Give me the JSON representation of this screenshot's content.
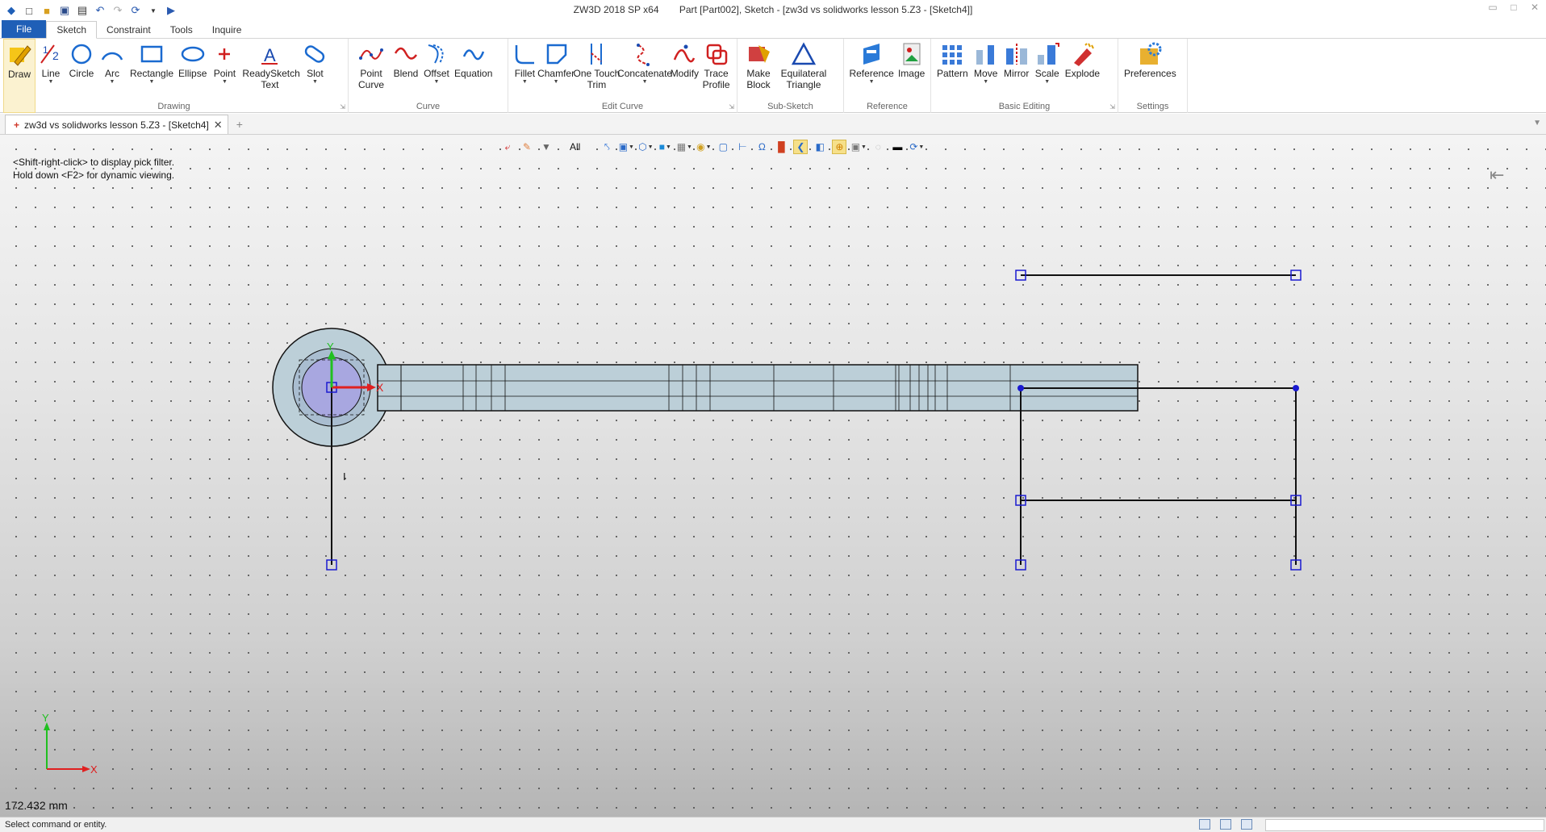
{
  "window": {
    "app_title": "ZW3D 2018 SP x64",
    "doc_title": "Part [Part002],  Sketch - [zw3d vs solidworks lesson 5.Z3 - [Sketch4]]"
  },
  "menu_tabs": [
    "File",
    "Sketch",
    "Constraint",
    "Tools",
    "Inquire"
  ],
  "active_tab": "Sketch",
  "ribbon": {
    "drawing": {
      "label": "Drawing",
      "buttons": [
        "Draw",
        "Line",
        "Circle",
        "Arc",
        "Rectangle",
        "Ellipse",
        "Point",
        "ReadySketch Text",
        "Slot"
      ]
    },
    "curve": {
      "label": "Curve",
      "buttons": [
        "Point Curve",
        "Blend",
        "Offset",
        "Equation"
      ]
    },
    "edit_curve": {
      "label": "Edit Curve",
      "buttons": [
        "Fillet",
        "Chamfer",
        "One Touch Trim",
        "Concatenate",
        "Modify",
        "Trace Profile"
      ]
    },
    "sub_sketch": {
      "label": "Sub-Sketch",
      "buttons": [
        "Make Block",
        "Equilateral Triangle"
      ]
    },
    "reference": {
      "label": "Reference",
      "buttons": [
        "Reference",
        "Image"
      ]
    },
    "basic_editing": {
      "label": "Basic Editing",
      "buttons": [
        "Pattern",
        "Move",
        "Mirror",
        "Scale",
        "Explode"
      ]
    },
    "settings": {
      "label": "Settings",
      "buttons": [
        "Preferences"
      ]
    }
  },
  "doc_tab": "zw3d vs solidworks lesson 5.Z3 - [Sketch4]",
  "viewport": {
    "filter": "All",
    "hint_line1": "<Shift-right-click> to display pick filter.",
    "hint_line2": "Hold down <F2> for dynamic viewing.",
    "axis_x": "X",
    "axis_y": "Y",
    "scale_readout": "172.432 mm"
  },
  "status": {
    "message": "Select command or entity."
  },
  "colors": {
    "file_tab": "#1f5fb7",
    "grid_dot": "#4a4a4a",
    "part_fill": "#bccfd8",
    "axis_x": "#e02020",
    "axis_y": "#20c020",
    "handle": "#1a1ad0"
  }
}
